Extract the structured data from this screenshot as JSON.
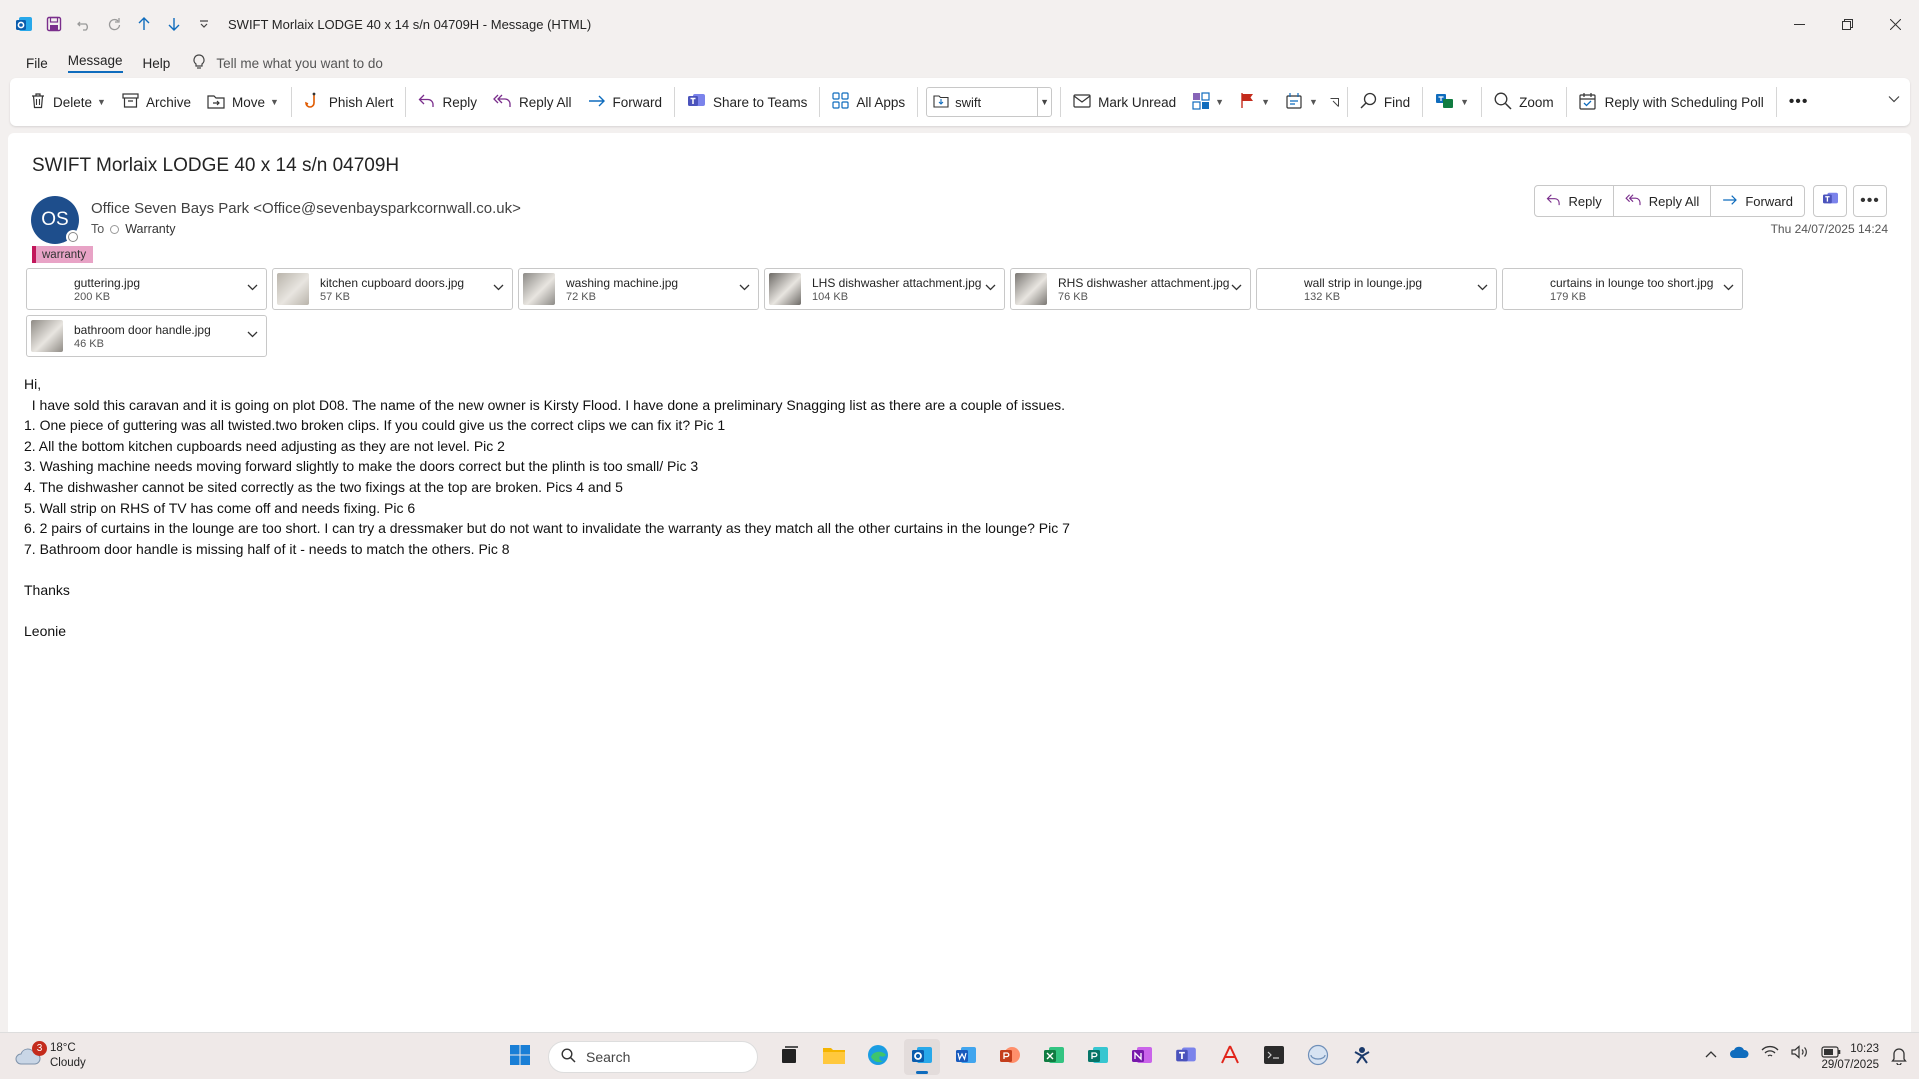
{
  "window": {
    "title": "SWIFT Morlaix LODGE 40 x 14 s/n 04709H  -  Message (HTML)"
  },
  "menu": {
    "file": "File",
    "message": "Message",
    "help": "Help",
    "tellme": "Tell me what you want to do"
  },
  "ribbon": {
    "delete": "Delete",
    "archive": "Archive",
    "move": "Move",
    "phish_alert": "Phish Alert",
    "reply": "Reply",
    "reply_all": "Reply All",
    "forward": "Forward",
    "share_teams": "Share to Teams",
    "all_apps": "All Apps",
    "quick_step": "swift",
    "mark_unread": "Mark Unread",
    "find": "Find",
    "zoom": "Zoom",
    "scheduling_poll": "Reply with Scheduling Poll"
  },
  "message": {
    "subject": "SWIFT Morlaix LODGE 40 x 14 s/n 04709H",
    "avatar_initials": "OS",
    "sender": "Office Seven Bays Park <Office@sevenbaysparkcornwall.co.uk>",
    "to_label": "To",
    "recipient": "Warranty",
    "category": "warranty",
    "date": "Thu 24/07/2025 14:24",
    "actions": {
      "reply": "Reply",
      "reply_all": "Reply All",
      "forward": "Forward"
    }
  },
  "attachments": [
    {
      "name": "guttering.jpg",
      "size": "200 KB",
      "thumb": "none"
    },
    {
      "name": "kitchen cupboard doors.jpg",
      "size": "57 KB",
      "thumb": "#b9b4ab"
    },
    {
      "name": "washing machine.jpg",
      "size": "72 KB",
      "thumb": "#8c8a86"
    },
    {
      "name": "LHS dishwasher attachment.jpg",
      "size": "104 KB",
      "thumb": "#6d6a66"
    },
    {
      "name": "RHS dishwasher attachment.jpg",
      "size": "76 KB",
      "thumb": "#7a7773"
    },
    {
      "name": "wall strip in lounge.jpg",
      "size": "132 KB",
      "thumb": "none"
    },
    {
      "name": "curtains in lounge too short.jpg",
      "size": "179 KB",
      "thumb": "none"
    },
    {
      "name": "bathroom door handle.jpg",
      "size": "46 KB",
      "thumb": "#8f8b85"
    }
  ],
  "body": {
    "greeting": "Hi,",
    "intro": "  I have sold this caravan and it is going on plot D08. The name of the new owner is Kirsty Flood. I have done a preliminary Snagging list as there are a couple of issues.",
    "items": [
      "1. One piece of guttering was all twisted.two broken clips. If you could give us the correct clips we can fix it? Pic 1",
      "2. All the bottom kitchen cupboards need adjusting as they are not level. Pic 2",
      "3. Washing machine needs moving forward slightly to make the doors correct but the plinth is too small/ Pic 3",
      "4. The dishwasher cannot be sited correctly as the two fixings at the top are broken. Pics 4 and 5",
      "5. Wall strip on RHS of TV has come off and needs fixing. Pic 6",
      "6. 2 pairs of curtains in the lounge are too short. I can try a dressmaker but do not want to invalidate the warranty as they match all the other curtains in the lounge? Pic 7",
      "7. Bathroom door handle is missing half of it - needs to match the others. Pic 8"
    ],
    "thanks": "Thanks",
    "signature": "Leonie"
  },
  "taskbar": {
    "weather_badge": "3",
    "temperature": "18°C",
    "condition": "Cloudy",
    "search": "Search",
    "time": "10:23",
    "date": "29/07/2025"
  },
  "colors": {
    "accent": "#0f6cbd",
    "avatar": "#1e4e8c",
    "category": "#e8a3c6"
  }
}
